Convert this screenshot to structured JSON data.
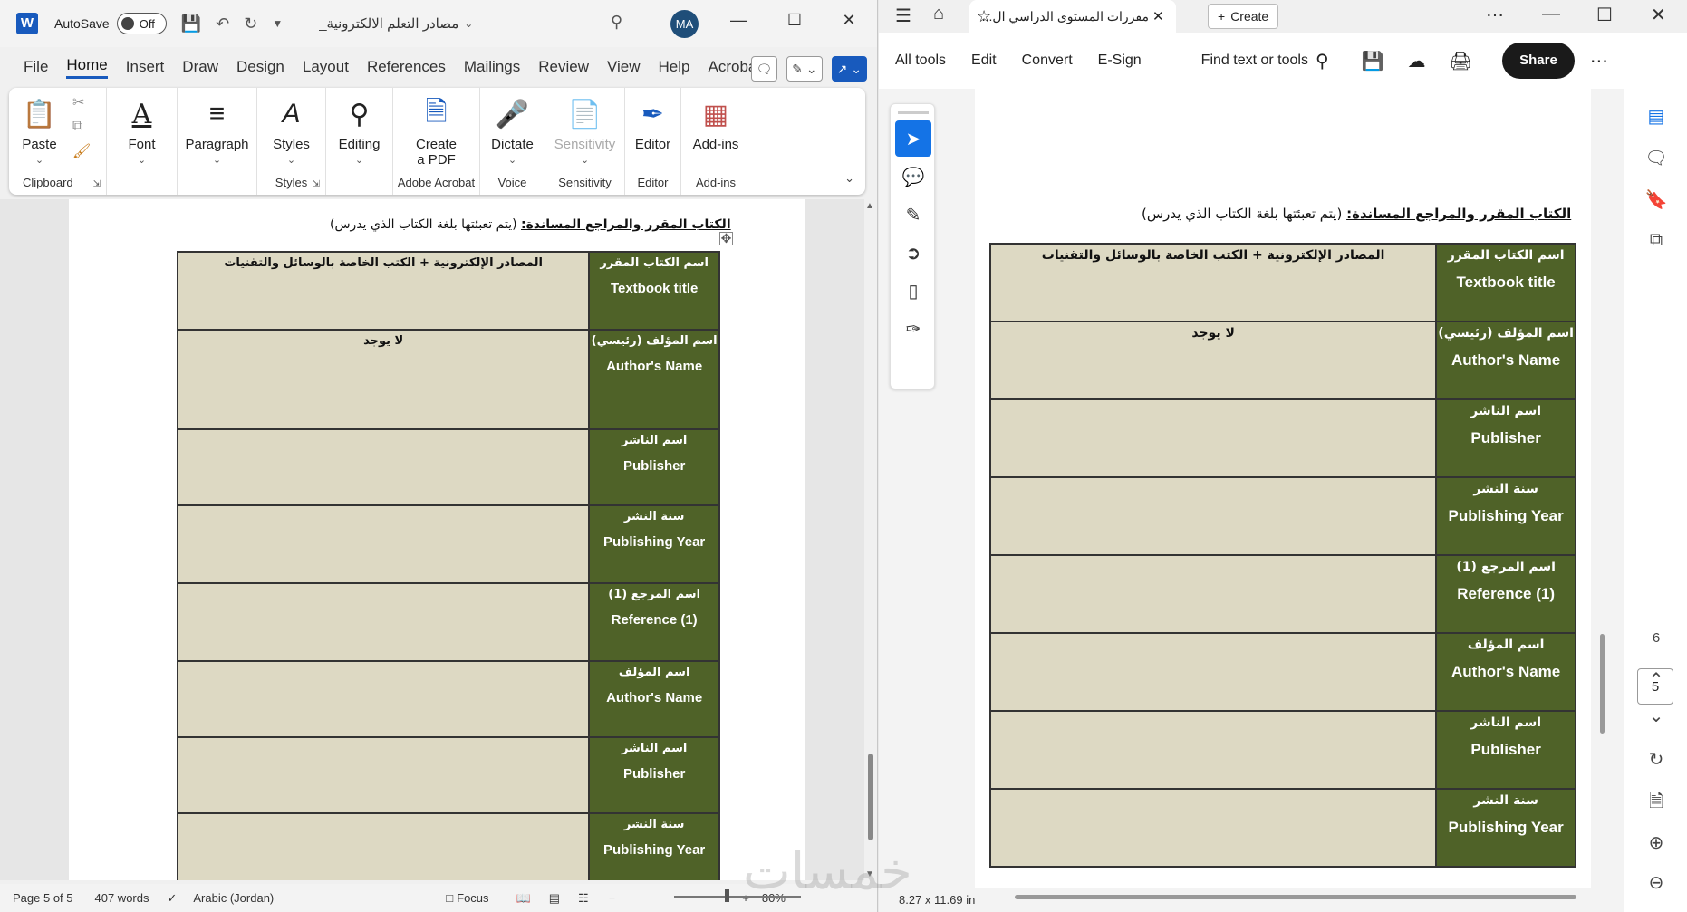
{
  "word": {
    "title_bar": {
      "logo": "W",
      "autosave_label": "AutoSave",
      "autosave_state": "Off",
      "doc_title": "مصادر التعلم الالكترونية_",
      "user_initials": "MA"
    },
    "menu": [
      "File",
      "Home",
      "Insert",
      "Draw",
      "Design",
      "Layout",
      "References",
      "Mailings",
      "Review",
      "View",
      "Help",
      "Acrobat"
    ],
    "ribbon": {
      "paste": "Paste",
      "clipboard": "Clipboard",
      "font": "Font",
      "paragraph": "Paragraph",
      "styles": "Styles",
      "styles_group": "Styles",
      "editing": "Editing",
      "create_pdf_1": "Create",
      "create_pdf_2": "a PDF",
      "adobe_acrobat": "Adobe Acrobat",
      "dictate": "Dictate",
      "voice": "Voice",
      "sensitivity": "Sensitivity",
      "sensitivity_group": "Sensitivity",
      "editor": "Editor",
      "editor_group": "Editor",
      "addins": "Add-ins",
      "addins_group": "Add-ins"
    },
    "status": {
      "page": "Page 5 of 5",
      "words": "407 words",
      "language": "Arabic (Jordan)",
      "focus": "Focus",
      "zoom": "80%"
    }
  },
  "document": {
    "heading_bold": "الكتاب المقرر والمراجع المساندة:",
    "heading_rest": " (يتم تعبئتها بلغة الكتاب الذي يدرس)",
    "rows": [
      {
        "ar": "اسم الكتاب المقرر",
        "en": "Textbook title",
        "value": "المصادر الإلكترونية + الكتب الخاصة بالوسائل والتقنيات"
      },
      {
        "ar": "اسم المؤلف (رئيسي)",
        "en": "Author's Name",
        "value": "لا يوجد"
      },
      {
        "ar": "اسم الناشر",
        "en": "Publisher",
        "value": ""
      },
      {
        "ar": "سنة النشر",
        "en": "Publishing Year",
        "value": ""
      },
      {
        "ar": "اسم المرجع (1)",
        "en": "Reference (1)",
        "value": ""
      },
      {
        "ar": "اسم المؤلف",
        "en": "Author's Name",
        "value": ""
      },
      {
        "ar": "اسم الناشر",
        "en": "Publisher",
        "value": ""
      },
      {
        "ar": "سنة النشر",
        "en": "Publishing Year",
        "value": ""
      }
    ]
  },
  "acrobat": {
    "tab_title": "مقررات المستوى الدراسي ال...",
    "create": "Create",
    "toolbar": [
      "All tools",
      "Edit",
      "Convert",
      "E-Sign"
    ],
    "find": "Find text or tools",
    "share": "Share",
    "page_current": "5",
    "page_next": "6",
    "page_size": "8.27 x 11.69 in"
  },
  "watermark": "خمسات"
}
